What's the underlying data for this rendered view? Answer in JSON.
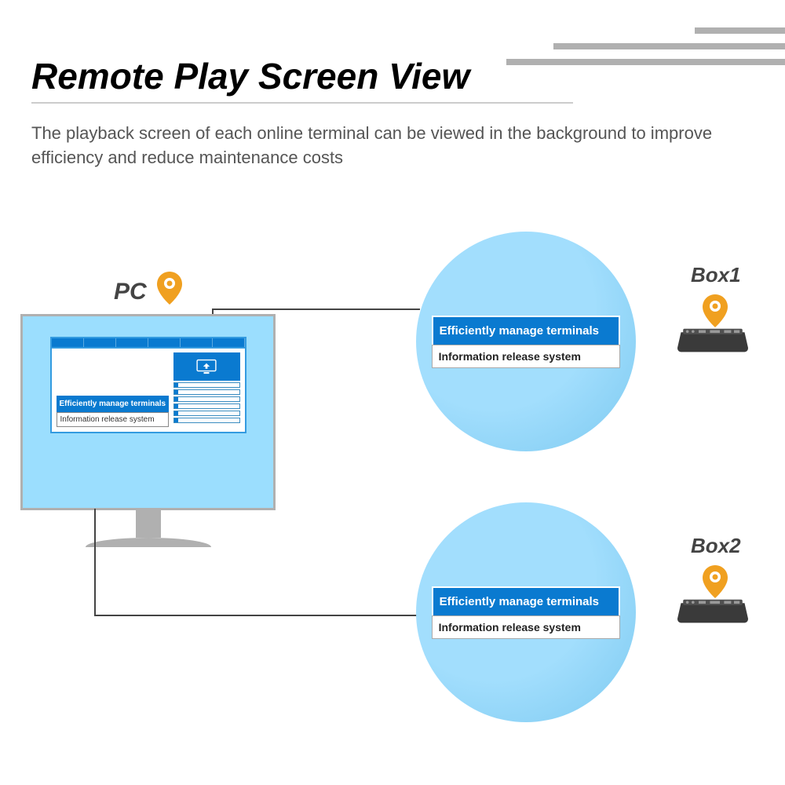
{
  "title": "Remote Play Screen View",
  "subtitle": "The playback screen of each online terminal can be viewed in the background to improve efficiency and reduce maintenance costs",
  "pc": {
    "label": "PC",
    "banner": "Efficiently manage terminals",
    "caption": "Information release system"
  },
  "boxes": [
    {
      "label": "Box1",
      "banner": "Efficiently manage terminals",
      "caption": "Information release system"
    },
    {
      "label": "Box2",
      "banner": "Efficiently manage terminals",
      "caption": "Information release system"
    }
  ],
  "colors": {
    "accent": "#0a7ad0",
    "light": "#9bdefe",
    "pin": "#f0a020"
  }
}
